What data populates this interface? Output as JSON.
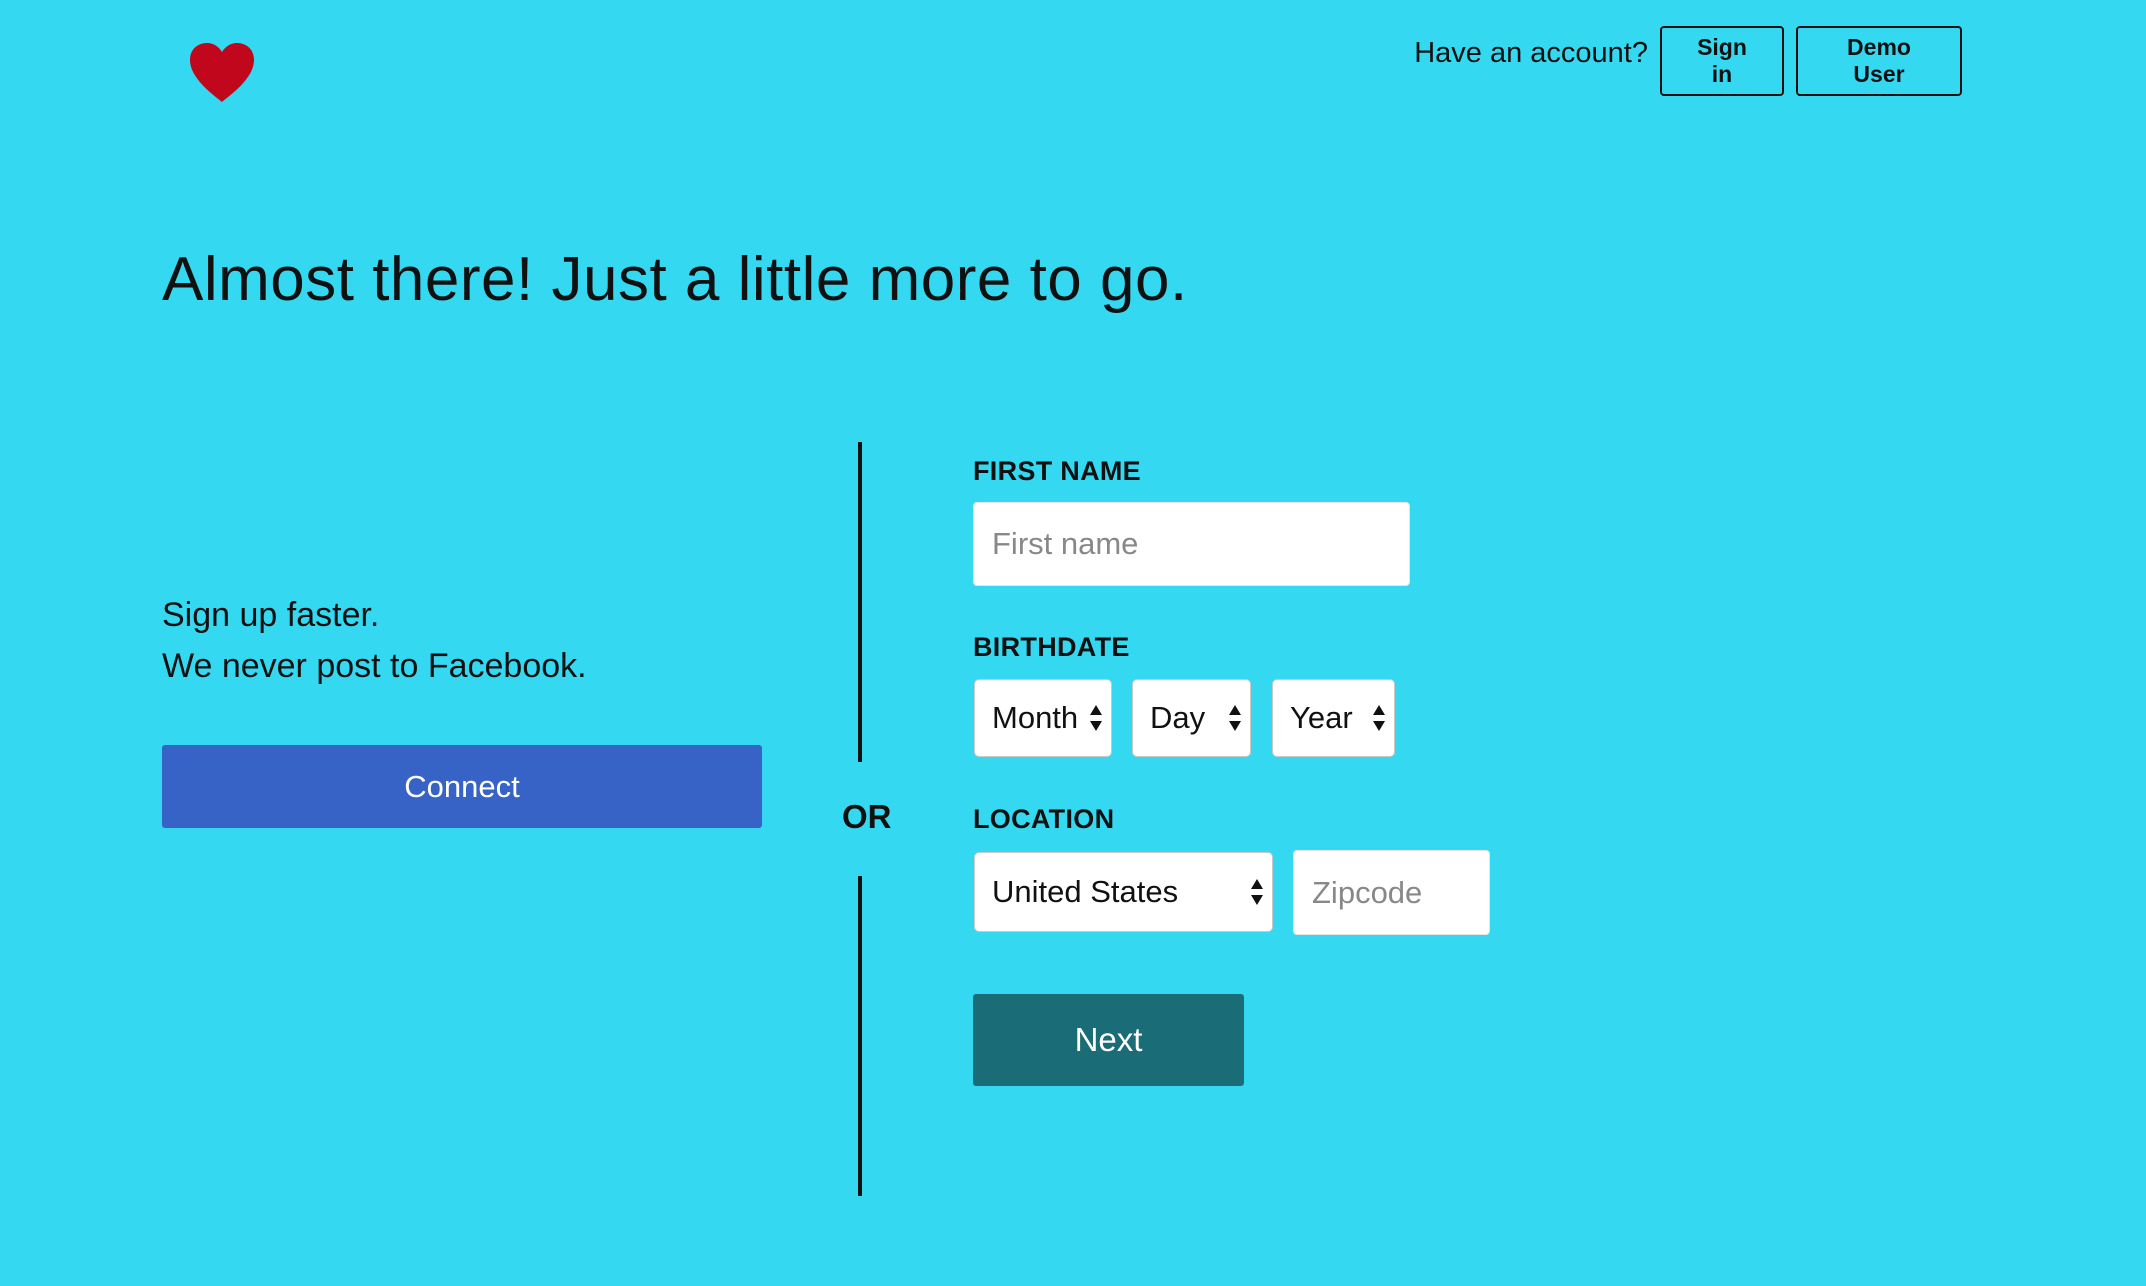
{
  "header": {
    "logo_icon": "heart-icon",
    "logo_color": "#c0071b",
    "have_account": "Have an account?",
    "sign_in_label": "Sign in",
    "demo_user_label": "Demo User"
  },
  "headline": "Almost there! Just a little more to go.",
  "facebook": {
    "line1": "Sign up faster.",
    "line2": "We never post to Facebook.",
    "connect_label": "Connect",
    "connect_color": "#3763c6"
  },
  "divider": {
    "or_label": "OR"
  },
  "form": {
    "first_name_label": "FIRST NAME",
    "first_name_placeholder": "First name",
    "first_name_value": "",
    "birthdate_label": "BIRTHDATE",
    "month_value": "Month",
    "day_value": "Day",
    "year_value": "Year",
    "location_label": "LOCATION",
    "country_value": "United States",
    "zipcode_placeholder": "Zipcode",
    "zipcode_value": "",
    "next_label": "Next",
    "next_color": "#1a6c77"
  },
  "colors": {
    "background": "#34d8f1"
  }
}
